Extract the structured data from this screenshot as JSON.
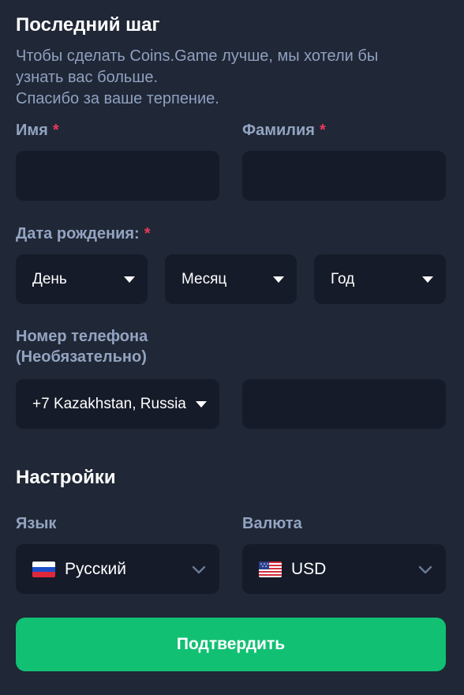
{
  "header": {
    "title": "Последний шаг",
    "subtitle_line1": "Чтобы сделать Coins.Game лучше, мы хотели бы",
    "subtitle_line2": "узнать вас больше.",
    "subtitle_line3": "Спасибо за ваше терпение."
  },
  "form": {
    "first_name": {
      "label": "Имя",
      "required_mark": "*",
      "value": ""
    },
    "last_name": {
      "label": "Фамилия",
      "required_mark": "*",
      "value": ""
    },
    "birth_date": {
      "label": "Дата рождения:",
      "required_mark": "*",
      "day": "День",
      "month": "Месяц",
      "year": "Год"
    },
    "phone": {
      "label_line1": "Номер телефона",
      "label_line2": "(Необязательно)",
      "country_code": "+7 Kazakhstan, Russia",
      "number_value": ""
    }
  },
  "settings": {
    "title": "Настройки",
    "language": {
      "label": "Язык",
      "value": "Русский",
      "flag_icon": "russia-flag-icon"
    },
    "currency": {
      "label": "Валюта",
      "value": "USD",
      "flag_icon": "usa-flag-icon"
    }
  },
  "submit": {
    "label": "Подтвердить"
  },
  "colors": {
    "background": "#202736",
    "field": "#151b28",
    "label": "#93a4c1",
    "required": "#e8395a",
    "accent": "#11c073"
  }
}
